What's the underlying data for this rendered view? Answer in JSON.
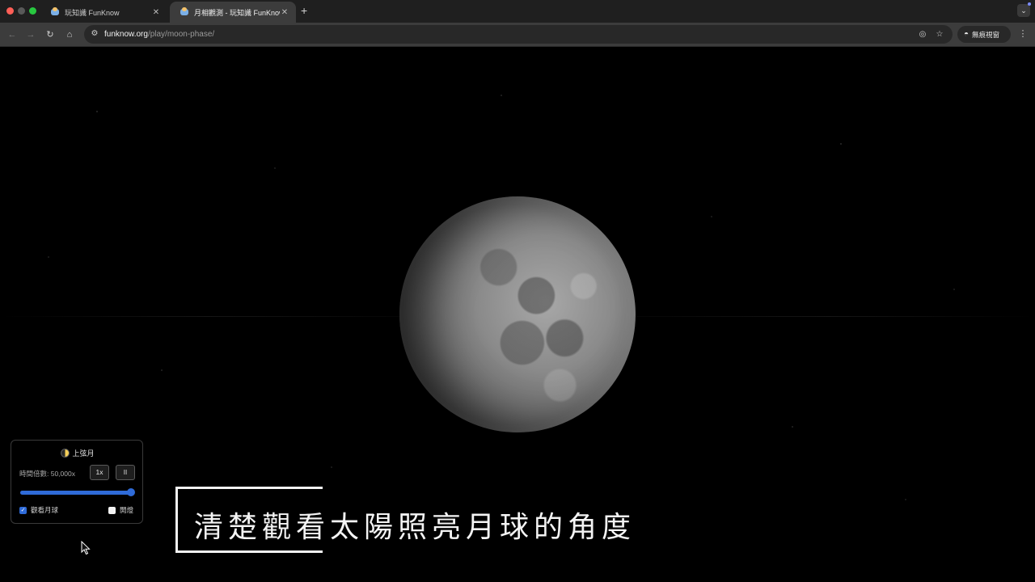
{
  "window": {
    "traffic_lights": [
      "close",
      "minimize",
      "maximize"
    ]
  },
  "tabs": [
    {
      "title": "玩知識 FunKnow",
      "active": false,
      "icon": "funknow-favicon"
    },
    {
      "title": "月相觀測 - 玩知識 FunKnow",
      "active": true,
      "icon": "funknow-favicon"
    }
  ],
  "toolbar": {
    "back_icon": "back-arrow-icon",
    "forward_icon": "forward-arrow-icon",
    "reload_icon": "reload-icon",
    "home_icon": "home-icon",
    "url_host": "funknow.org",
    "url_path": "/play/moon-phase/",
    "incognito_label": "無痕視窗"
  },
  "panel": {
    "phase_name": "上弦月",
    "phase_icon": "first-quarter-moon-icon",
    "speed_label": "時間倍數: 50,000x",
    "speed_reset_label": "1x",
    "pause_label": "II",
    "slider_value": 1.0,
    "view_moon_label": "觀看月球",
    "view_moon_checked": true,
    "lights_label": "開燈",
    "lights_checked": false
  },
  "caption": {
    "text": "清楚觀看太陽照亮月球的角度"
  },
  "colors": {
    "accent": "#2f6bd8",
    "background": "#000000",
    "chrome_dark": "#1f1f1f",
    "chrome_toolbar": "#3c3c3c"
  }
}
